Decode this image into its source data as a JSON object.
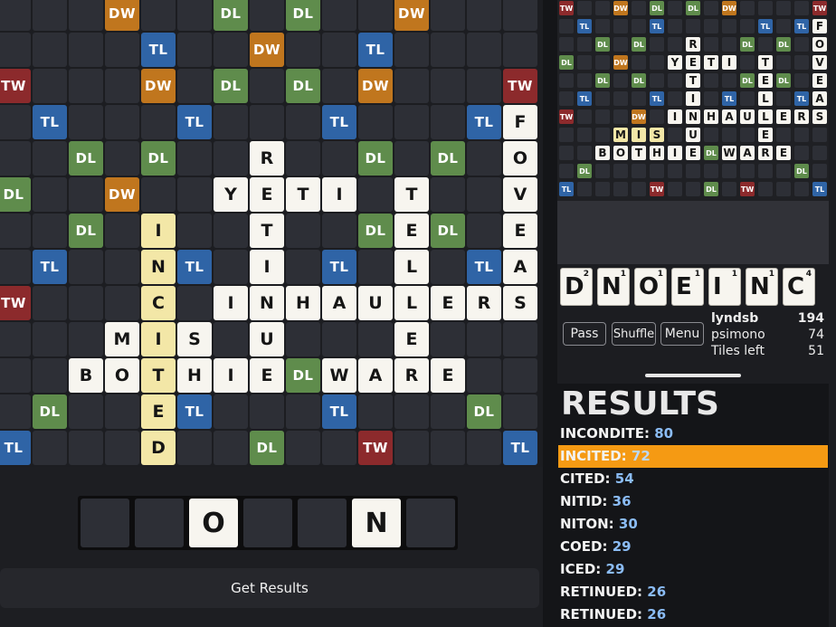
{
  "board": {
    "rows": [
      [
        ".",
        ".",
        ".",
        "DW",
        ".",
        ".",
        "DL",
        ".",
        "DL",
        ".",
        ".",
        "DW",
        ".",
        ".",
        "."
      ],
      [
        ".",
        ".",
        ".",
        ".",
        "TL",
        ".",
        ".",
        "DW",
        ".",
        ".",
        "TL",
        ".",
        ".",
        ".",
        "."
      ],
      [
        "TW",
        ".",
        ".",
        ".",
        "DW",
        ".",
        "DL",
        ".",
        "DL",
        ".",
        "DW",
        ".",
        ".",
        ".",
        "TW"
      ],
      [
        ".",
        "TL",
        ".",
        ".",
        ".",
        "TL",
        ".",
        ".",
        ".",
        "TL",
        ".",
        ".",
        ".",
        "TL",
        "F"
      ],
      [
        ".",
        ".",
        "DL",
        ".",
        "DL",
        ".",
        ".",
        "R",
        ".",
        ".",
        "DL",
        ".",
        "DL",
        ".",
        "O"
      ],
      [
        "DL",
        ".",
        ".",
        "DW",
        ".",
        ".",
        "Y",
        "E",
        "T",
        "I",
        ".",
        "T",
        ".",
        ".",
        "V"
      ],
      [
        ".",
        ".",
        "DL",
        ".",
        "I",
        ".",
        ".",
        "T",
        ".",
        ".",
        "DL",
        "E",
        "DL",
        ".",
        "E"
      ],
      [
        ".",
        "TL",
        ".",
        ".",
        "N",
        "TL",
        ".",
        "I",
        ".",
        "TL",
        ".",
        "L",
        ".",
        "TL",
        "A"
      ],
      [
        "TW",
        ".",
        ".",
        ".",
        "C",
        ".",
        "I",
        "N",
        "H",
        "A",
        "U",
        "L",
        "E",
        "R",
        "S"
      ],
      [
        ".",
        ".",
        ".",
        "M",
        "I",
        "S",
        ".",
        "U",
        ".",
        ".",
        ".",
        "E",
        ".",
        ".",
        "."
      ],
      [
        ".",
        ".",
        "B",
        "O",
        "T",
        "H",
        "I",
        "E",
        "DL",
        "W",
        "A",
        "R",
        "E",
        ".",
        "."
      ],
      [
        ".",
        "DL",
        ".",
        ".",
        "E",
        "TL",
        ".",
        ".",
        ".",
        "TL",
        ".",
        ".",
        ".",
        "DL",
        "."
      ],
      [
        "TL",
        ".",
        ".",
        ".",
        "D",
        ".",
        ".",
        "DL",
        ".",
        ".",
        "TW",
        ".",
        ".",
        ".",
        "TL"
      ]
    ],
    "highlight": [
      "6,4",
      "7,4",
      "8,4",
      "9,4",
      "10,4",
      "11,4",
      "12,4"
    ]
  },
  "mini_board": {
    "rows": [
      [
        "TW",
        ".",
        ".",
        "DW",
        ".",
        "DL",
        ".",
        "DL",
        ".",
        "DW",
        ".",
        ".",
        ".",
        ".",
        "TW"
      ],
      [
        ".",
        "TL",
        ".",
        ".",
        ".",
        "TL",
        ".",
        ".",
        ".",
        ".",
        ".",
        "TL",
        ".",
        "TL",
        "F"
      ],
      [
        ".",
        ".",
        "DL",
        ".",
        "DL",
        ".",
        ".",
        "R",
        ".",
        ".",
        "DL",
        ".",
        "DL",
        ".",
        "O"
      ],
      [
        "DL",
        ".",
        ".",
        "DW",
        ".",
        ".",
        "Y",
        "E",
        "T",
        "I",
        ".",
        "T",
        ".",
        ".",
        "V"
      ],
      [
        ".",
        ".",
        "DL",
        ".",
        "DL",
        ".",
        ".",
        "T",
        ".",
        ".",
        "DL",
        "E",
        "DL",
        ".",
        "E"
      ],
      [
        ".",
        "TL",
        ".",
        ".",
        ".",
        "TL",
        ".",
        "I",
        ".",
        "TL",
        ".",
        "L",
        ".",
        "TL",
        "A"
      ],
      [
        "TW",
        ".",
        ".",
        ".",
        "DW",
        ".",
        "I",
        "N",
        "H",
        "A",
        "U",
        "L",
        "E",
        "R",
        "S"
      ],
      [
        ".",
        ".",
        ".",
        "M",
        "I",
        "S",
        ".",
        "U",
        ".",
        ".",
        ".",
        "E",
        ".",
        ".",
        "."
      ],
      [
        ".",
        ".",
        "B",
        "O",
        "T",
        "H",
        "I",
        "E",
        "DL",
        "W",
        "A",
        "R",
        "E",
        ".",
        "."
      ],
      [
        ".",
        "DL",
        ".",
        ".",
        ".",
        ".",
        ".",
        ".",
        ".",
        ".",
        ".",
        ".",
        ".",
        "DL",
        "."
      ],
      [
        "TL",
        ".",
        ".",
        ".",
        ".",
        "TW",
        ".",
        ".",
        "DL",
        ".",
        "TW",
        ".",
        ".",
        ".",
        "TL"
      ]
    ],
    "highlight": [
      "7,3",
      "7,4",
      "7,5"
    ]
  },
  "input_rack": [
    "",
    "",
    "O",
    "",
    "",
    "N",
    ""
  ],
  "get_results_label": "Get Results",
  "player_rack": [
    {
      "letter": "D",
      "points": "2"
    },
    {
      "letter": "N",
      "points": "1"
    },
    {
      "letter": "O",
      "points": "1"
    },
    {
      "letter": "E",
      "points": "1"
    },
    {
      "letter": "I",
      "points": "1"
    },
    {
      "letter": "N",
      "points": "1"
    },
    {
      "letter": "C",
      "points": "4"
    }
  ],
  "buttons": {
    "pass": "Pass",
    "shuffle": "Shuffle",
    "menu": "Menu"
  },
  "scores": [
    {
      "name": "lyndsb",
      "value": "194",
      "bold": true
    },
    {
      "name": "psimono",
      "value": "74",
      "bold": false
    },
    {
      "name": "Tiles left",
      "value": "51",
      "bold": false
    }
  ],
  "results": {
    "title": "RESULTS",
    "items": [
      {
        "word": "INCONDITE",
        "points": "80",
        "selected": false
      },
      {
        "word": "INCITED",
        "points": "72",
        "selected": true
      },
      {
        "word": "CITED",
        "points": "54",
        "selected": false
      },
      {
        "word": "NITID",
        "points": "36",
        "selected": false
      },
      {
        "word": "NITON",
        "points": "30",
        "selected": false
      },
      {
        "word": "COED",
        "points": "29",
        "selected": false
      },
      {
        "word": "ICED",
        "points": "29",
        "selected": false
      },
      {
        "word": "RETINUED",
        "points": "26",
        "selected": false
      },
      {
        "word": "RETINUED",
        "points": "26",
        "selected": false
      }
    ]
  },
  "colors": {
    "TW": "#8c2a2c",
    "DW": "#c0761e",
    "TL": "#2f64a6",
    "DL": "#5f8c4c",
    "tile": "#f7f5ef",
    "highlight_tile": "#f3e7a7",
    "selected_row": "#f59a13",
    "points": "#8bbcf5"
  }
}
